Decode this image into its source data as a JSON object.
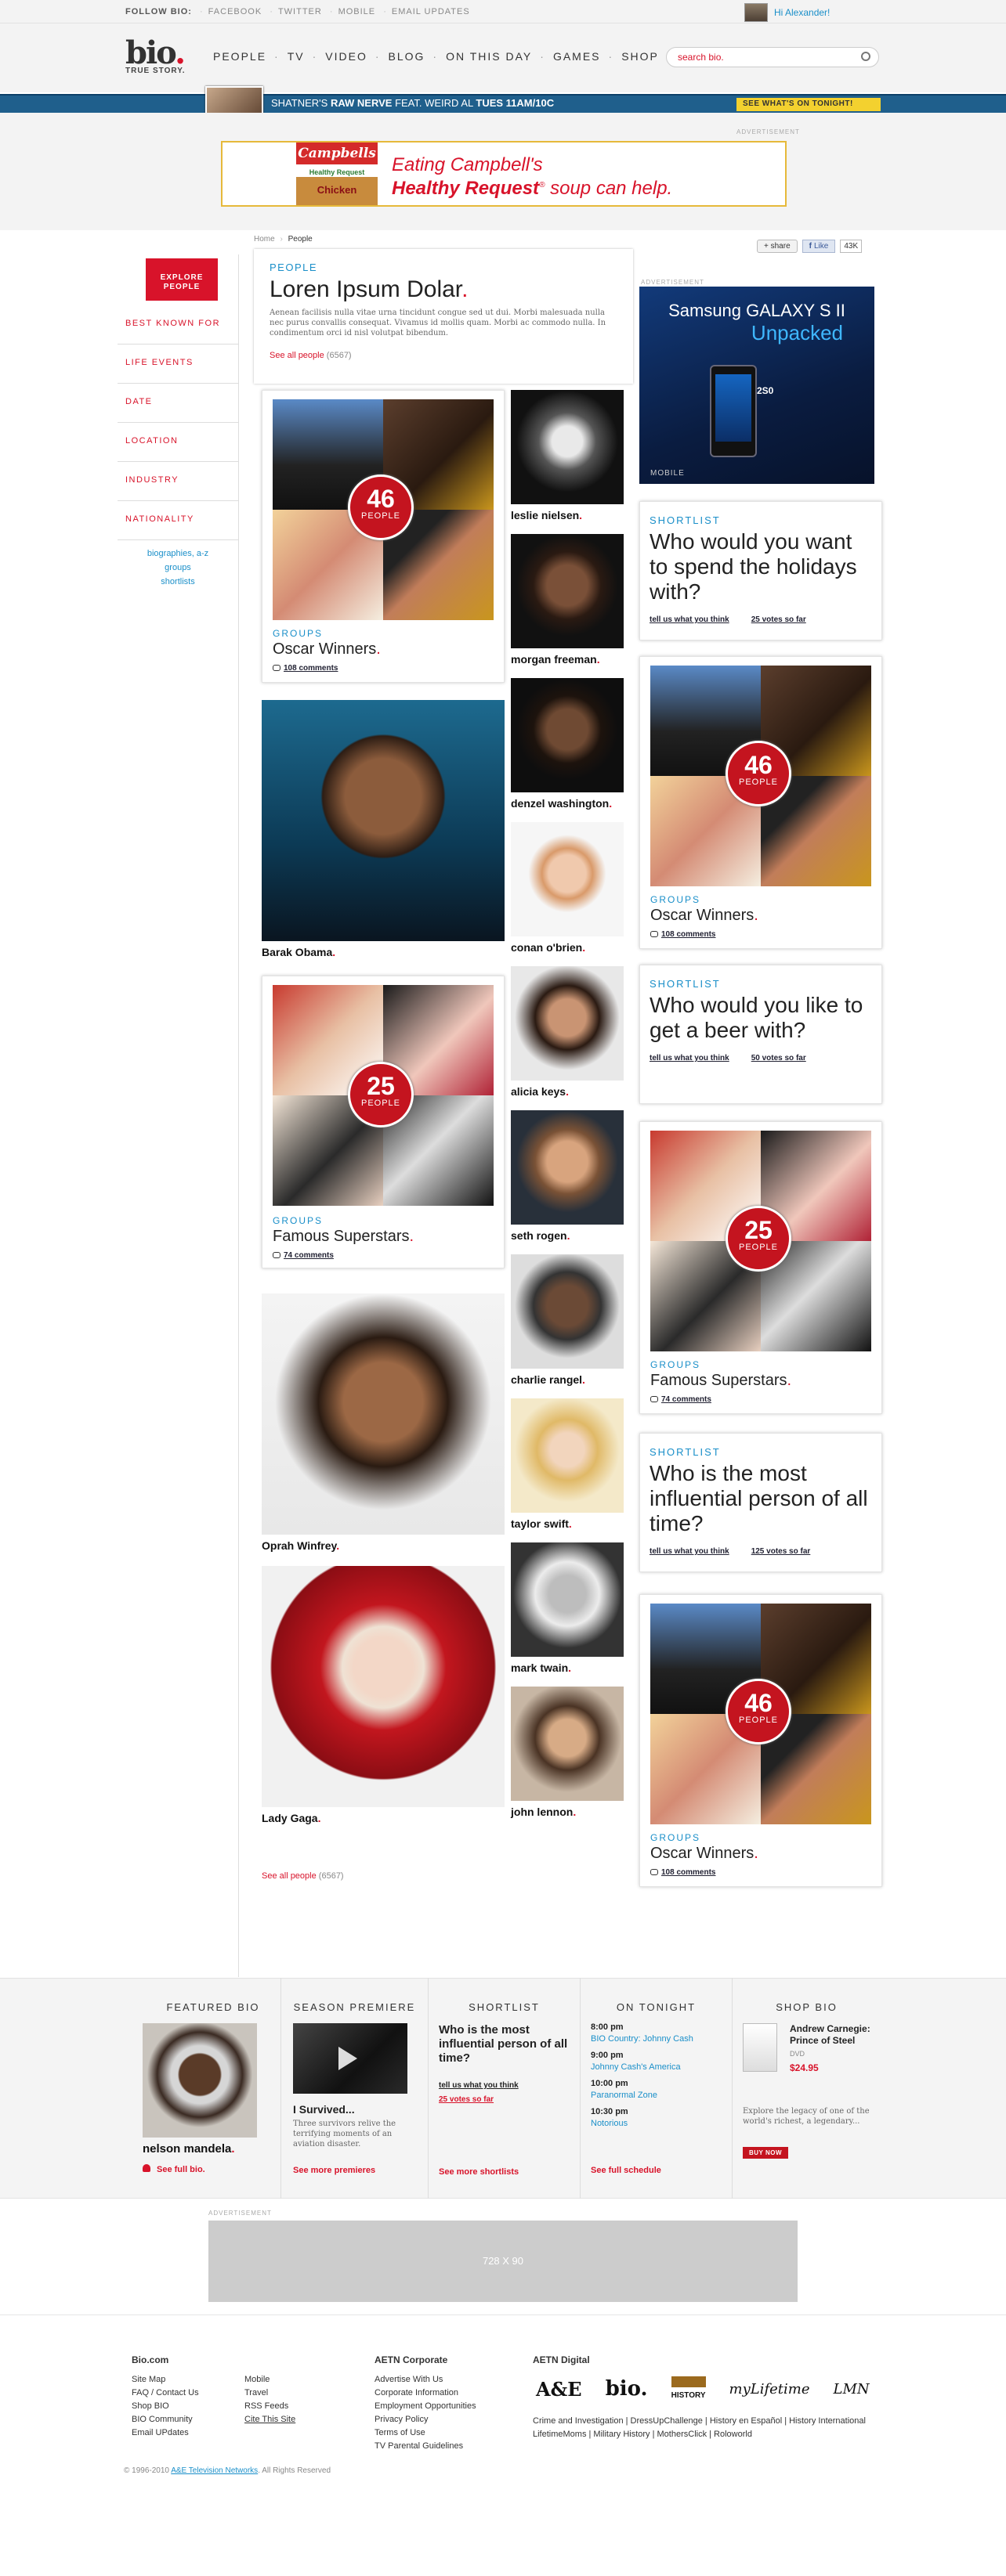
{
  "topbar": {
    "follow_label": "FOLLOW BIO:",
    "links": [
      "FACEBOOK",
      "TWITTER",
      "MOBILE",
      "EMAIL UPDATES"
    ],
    "user_greeting": "Hi Alexander!"
  },
  "header": {
    "logo_text": "bio",
    "logo_dot": ".",
    "tagline": "TRUE STORY.",
    "nav": [
      "PEOPLE",
      "TV",
      "VIDEO",
      "BLOG",
      "ON THIS DAY",
      "GAMES",
      "SHOP"
    ],
    "search_placeholder": "search bio."
  },
  "promo": {
    "pre": "SHATNER'S",
    "show": "RAW NERVE",
    "feat": "FEAT. WEIRD AL",
    "time": "TUES 11AM/10C",
    "button": "SEE WHAT'S ON TONIGHT!"
  },
  "top_ad": {
    "label": "ADVERTISEMENT",
    "line1": "Eating Campbell's",
    "line2": "Healthy Request",
    "line2b": "soup can help.",
    "can_brand": "Campbells",
    "can_sub": "Healthy Request",
    "can_flavor": "Chicken"
  },
  "breadcrumb": {
    "home": "Home",
    "sep": "›",
    "current": "People"
  },
  "share": {
    "share_label": "+ share",
    "like_label": "Like",
    "like_count": "43K"
  },
  "leftnav": {
    "explore": "EXPLORE PEOPLE",
    "items": [
      "BEST KNOWN FOR",
      "LIFE EVENTS",
      "DATE",
      "LOCATION",
      "INDUSTRY",
      "NATIONALITY"
    ],
    "sublinks": [
      "biographies, a-z",
      "groups",
      "shortlists"
    ]
  },
  "intro": {
    "label": "PEOPLE",
    "title": "Loren Ipsum Dolar",
    "body": "Aenean facilisis nulla vitae urna tincidunt congue sed ut dui. Morbi malesuada nulla nec purus convallis consequat. Vivamus id mollis quam. Morbi ac commodo nulla. In condimentum orci id nisl volutpat bibendum.",
    "see_all": "See all people",
    "see_all_count": "(6567)"
  },
  "groups": [
    {
      "label": "GROUPS",
      "title": "Oscar Winners",
      "count": "46",
      "people_label": "PEOPLE",
      "comments": "108 comments"
    },
    {
      "label": "GROUPS",
      "title": "Famous Superstars",
      "count": "25",
      "people_label": "PEOPLE",
      "comments": "74 comments"
    }
  ],
  "people": {
    "large": [
      "Barak Obama",
      "Oprah Winfrey",
      "Lady Gaga"
    ],
    "small": [
      "leslie nielsen",
      "morgan freeman",
      "denzel washington",
      "conan o'brien",
      "alicia keys",
      "seth rogen",
      "charlie rangel",
      "taylor swift",
      "mark twain",
      "john lennon"
    ]
  },
  "see_all_bottom": {
    "text": "See all people",
    "count": "(6567)"
  },
  "right_ad": {
    "label": "ADVERTISEMENT",
    "brand": "Samsung GALAXY S II",
    "sub": "Unpacked",
    "badge": "2S0",
    "footer": "MOBILE"
  },
  "shortlists": [
    {
      "label": "SHORTLIST",
      "question": "Who would you want to spend the holidays with?",
      "cta": "tell us what you think",
      "votes": "25 votes so far"
    },
    {
      "label": "SHORTLIST",
      "question": "Who would you like to get a beer with?",
      "cta": "tell us what you think",
      "votes": "50 votes so far"
    },
    {
      "label": "SHORTLIST",
      "question": "Who is the most influential person of all time?",
      "cta": "tell us what you think",
      "votes": "125 votes so far"
    }
  ],
  "footer_modules": {
    "featured": {
      "heading": "FEATURED BIO",
      "name": "nelson mandela",
      "link": "See full bio."
    },
    "premiere": {
      "heading": "SEASON PREMIERE",
      "title": "I Survived...",
      "desc": "Three survivors relive the terrifying moments of an aviation disaster.",
      "link": "See more premieres"
    },
    "shortlist": {
      "heading": "SHORTLIST",
      "question": "Who is the most influential person of all time?",
      "cta": "tell us what you think",
      "votes": "25 votes so far",
      "link": "See more shortlists"
    },
    "tonight": {
      "heading": "ON TONIGHT",
      "items": [
        {
          "time": "8:00 pm",
          "show": "BIO Country: Johnny Cash"
        },
        {
          "time": "9:00 pm",
          "show": "Johnny Cash's America"
        },
        {
          "time": "10:00 pm",
          "show": "Paranormal Zone"
        },
        {
          "time": "10:30 pm",
          "show": "Notorious"
        }
      ],
      "link": "See full schedule"
    },
    "shop": {
      "heading": "SHOP BIO",
      "product": "Andrew Carnegie: Prince of Steel",
      "format": "DVD",
      "price": "$24.95",
      "desc": "Explore the legacy of one of the world's richest, a legendary...",
      "button": "BUY NOW"
    }
  },
  "bottom_ad": {
    "label": "ADVERTISEMENT",
    "size": "728 X 90"
  },
  "footer": {
    "col1_title": "Bio.com",
    "col1a": [
      "Site Map",
      "FAQ / Contact Us",
      "Shop BIO",
      "BIO Community",
      "Email UPdates"
    ],
    "col1b": [
      "Mobile",
      "Travel",
      "RSS Feeds",
      "Cite This Site"
    ],
    "col2_title": "AETN Corporate",
    "col2": [
      "Advertise With Us",
      "Corporate Information",
      "Employment Opportunities",
      "Privacy Policy",
      "Terms of Use",
      "TV Parental Guidelines"
    ],
    "col3_title": "AETN Digital",
    "brands": [
      "A&E",
      "bio.",
      "HISTORY",
      "myLifetime",
      "LMN"
    ],
    "links_line1": "Crime and Investigation | DressUpChallenge | History en Español | History International",
    "links_line2": "LifetimeMoms | Military History | MothersClick | Roloworld",
    "copyright": "© 1996-2010",
    "copyright_link": "A&E Television Networks",
    "copyright_tail": ". All Rights Reserved"
  }
}
